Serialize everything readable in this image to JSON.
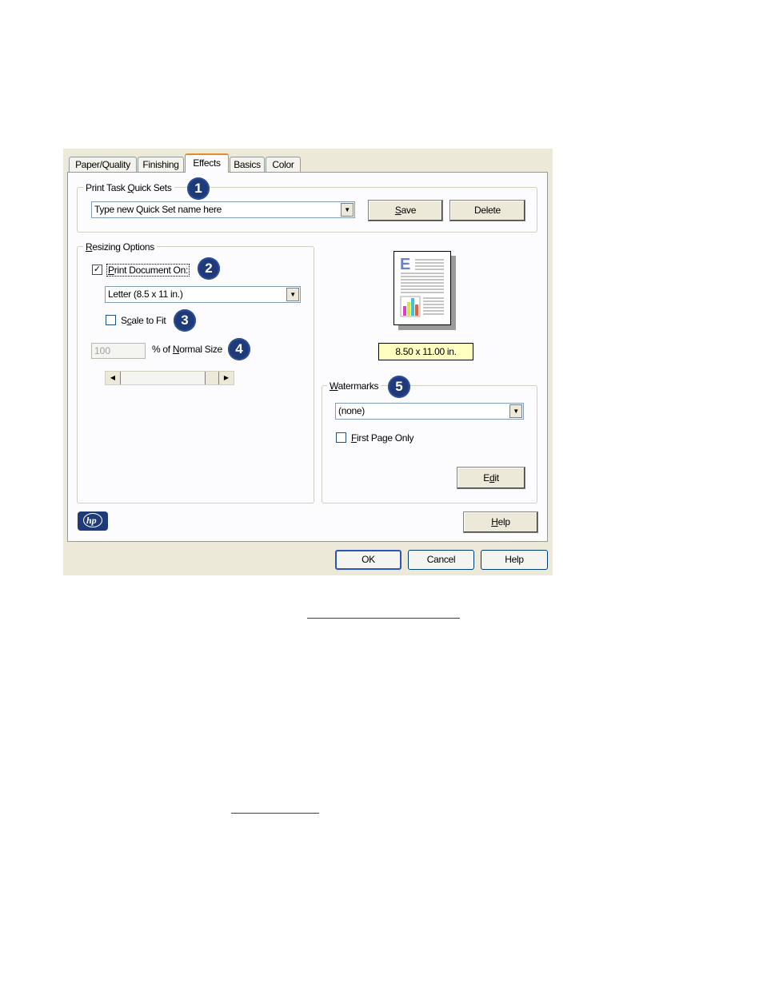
{
  "tabs": [
    {
      "label": "Paper/Quality"
    },
    {
      "label": "Finishing"
    },
    {
      "label": "Effects"
    },
    {
      "label": "Basics"
    },
    {
      "label": "Color"
    }
  ],
  "quick_sets": {
    "legend_pre": "Print Task ",
    "legend_u": "Q",
    "legend_post": "uick Sets",
    "badge": "1",
    "combo_value": "Type new Quick Set name here",
    "save_u": "S",
    "save_rest": "ave",
    "delete_label": "Delete"
  },
  "resizing": {
    "legend_u": "R",
    "legend_rest": "esizing Options",
    "print_doc_u": "P",
    "print_doc_rest": "rint Document On:",
    "print_doc_checked_glyph": "✓",
    "badge2": "2",
    "paper_value": "Letter (8.5 x 11 in.)",
    "scale_pre": "S",
    "scale_u": "c",
    "scale_post": "ale to Fit",
    "badge3": "3",
    "percent_value": "100",
    "percent_pre": "% of ",
    "percent_u": "N",
    "percent_post": "ormal Size",
    "badge4": "4"
  },
  "preview": {
    "size_label": "8.50 x 11.00 in.",
    "page_letter": "E"
  },
  "watermarks": {
    "legend_u": "W",
    "legend_rest": "atermarks",
    "badge5": "5",
    "value": "(none)",
    "first_u": "F",
    "first_rest": "irst Page Only",
    "edit_pre": "E",
    "edit_u": "d",
    "edit_post": "it"
  },
  "panel_help": {
    "u": "H",
    "rest": "elp"
  },
  "footer": {
    "ok": "OK",
    "cancel": "Cancel",
    "help": "Help"
  },
  "colors": {
    "badge": "#1f3a78",
    "active_tab_accent": "#e68b2c",
    "size_label_bg": "#ffffc0",
    "hp_logo": "#1f3a78",
    "link": "#1a3fa0"
  }
}
